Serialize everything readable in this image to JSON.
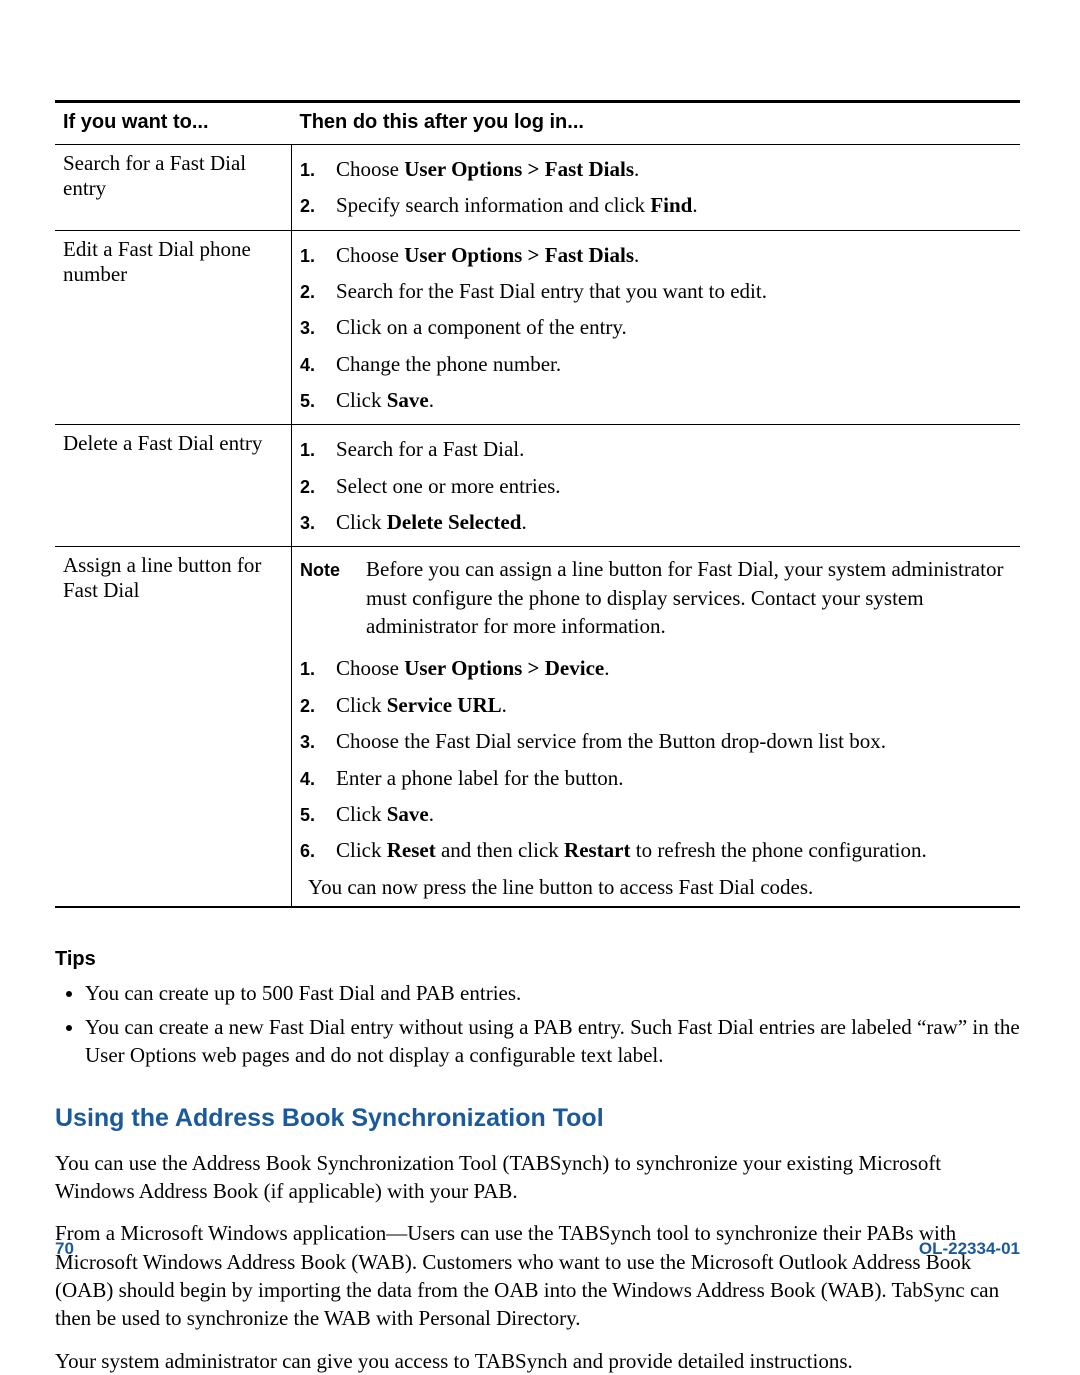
{
  "table": {
    "headers": {
      "a": "If you want to...",
      "b": "Then do this after you log in..."
    },
    "rows": [
      {
        "task": "Search for a Fast Dial entry",
        "steps": [
          [
            {
              "t": "Choose "
            },
            {
              "t": "User Options > Fast Dials",
              "b": true
            },
            {
              "t": "."
            }
          ],
          [
            {
              "t": "Specify search information and click "
            },
            {
              "t": "Find",
              "b": true
            },
            {
              "t": "."
            }
          ]
        ]
      },
      {
        "task": "Edit a Fast Dial phone number",
        "steps": [
          [
            {
              "t": "Choose "
            },
            {
              "t": "User Options > Fast Dials",
              "b": true
            },
            {
              "t": "."
            }
          ],
          [
            {
              "t": "Search for the Fast Dial entry that you want to edit."
            }
          ],
          [
            {
              "t": "Click on a component of the entry."
            }
          ],
          [
            {
              "t": "Change the phone number."
            }
          ],
          [
            {
              "t": "Click "
            },
            {
              "t": "Save",
              "b": true
            },
            {
              "t": "."
            }
          ]
        ]
      },
      {
        "task": "Delete a Fast Dial entry",
        "steps": [
          [
            {
              "t": "Search for a Fast Dial."
            }
          ],
          [
            {
              "t": "Select one or more entries."
            }
          ],
          [
            {
              "t": "Click "
            },
            {
              "t": "Delete Selected",
              "b": true
            },
            {
              "t": "."
            }
          ]
        ]
      },
      {
        "task": "Assign a line button for Fast Dial",
        "note_label": "Note",
        "note": "Before you can assign a line button for Fast Dial, your system administrator must configure the phone to display services. Contact your system administrator for more information.",
        "steps": [
          [
            {
              "t": "Choose "
            },
            {
              "t": "User Options > Device",
              "b": true
            },
            {
              "t": "."
            }
          ],
          [
            {
              "t": "Click "
            },
            {
              "t": "Service URL",
              "b": true
            },
            {
              "t": "."
            }
          ],
          [
            {
              "t": "Choose the Fast Dial service from the Button drop-down list box."
            }
          ],
          [
            {
              "t": "Enter a phone label for the button."
            }
          ],
          [
            {
              "t": "Click "
            },
            {
              "t": "Save",
              "b": true
            },
            {
              "t": "."
            }
          ],
          [
            {
              "t": "Click "
            },
            {
              "t": "Reset",
              "b": true
            },
            {
              "t": " and then click "
            },
            {
              "t": "Restart",
              "b": true
            },
            {
              "t": " to refresh the phone configuration."
            }
          ]
        ],
        "after": "You can now press the line button to access Fast Dial codes."
      }
    ]
  },
  "tips_heading": "Tips",
  "tips": [
    "You can create up to 500 Fast Dial and PAB entries.",
    "You can create a new Fast Dial entry without using a PAB entry. Such Fast Dial entries are labeled “raw” in the User Options web pages and do not display a configurable text label."
  ],
  "blue_heading": "Using the Address Book Synchronization Tool",
  "paragraphs": [
    "You can use the Address Book Synchronization Tool (TABSynch) to synchronize your existing Microsoft Windows Address Book (if applicable) with your PAB.",
    "From a Microsoft Windows application—Users can use the TABSynch tool to synchronize their PABs with Microsoft Windows Address Book (WAB). Customers who want to use the Microsoft Outlook Address Book (OAB) should begin by importing the data from the OAB into the Windows Address Book (WAB). TabSync can then be used to synchronize the WAB with Personal Directory.",
    "Your system administrator can give you access to TABSynch and provide detailed instructions."
  ],
  "footer": {
    "page": "70",
    "doc_id": "OL-22334-01"
  }
}
